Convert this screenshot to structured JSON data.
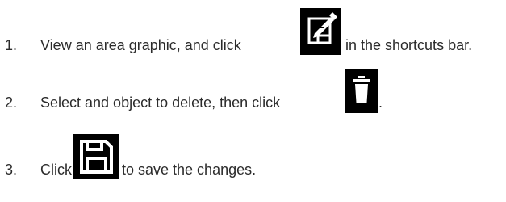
{
  "steps": [
    {
      "number": "1.",
      "before_icon": "View an area graphic, and click",
      "icon": "edit-icon",
      "after_icon": "in the shortcuts bar."
    },
    {
      "number": "2.",
      "before_icon": "Select and object to delete, then click",
      "icon": "trash-icon",
      "after_icon": "."
    },
    {
      "number": "3.",
      "before_icon": "Click",
      "icon": "save-icon",
      "after_icon": "to save the changes."
    }
  ]
}
